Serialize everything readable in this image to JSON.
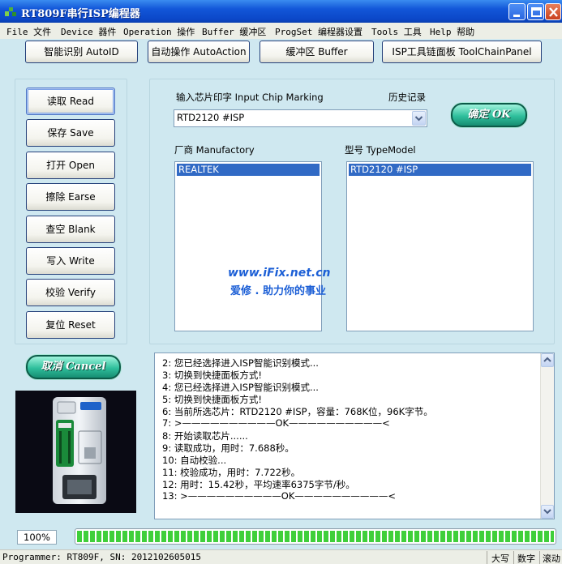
{
  "window": {
    "title": "RT809F串行ISP编程器"
  },
  "menu": [
    "File 文件",
    "Device 器件",
    "Operation 操作",
    "Buffer 缓冲区",
    "ProgSet 编程器设置",
    "Tools 工具",
    "Help 帮助"
  ],
  "toolbar": {
    "auto_identify": "智能识别 AutoID",
    "auto_action": "自动操作  AutoAction",
    "buffer": "缓冲区 Buffer",
    "toolchain": "ISP工具链面板  ToolChainPanel"
  },
  "ops": {
    "read": "读取 Read",
    "save": "保存 Save",
    "open": "打开 Open",
    "erase": "擦除 Earse",
    "blank": "查空 Blank",
    "write": "写入 Write",
    "verify": "校验 Verify",
    "reset": "复位 Reset"
  },
  "chip": {
    "marking_label": "输入芯片印字 Input Chip Marking",
    "history_label": "历史记录",
    "marking_value": "RTD2120 #ISP",
    "ok": "确定 OK",
    "manufactory_label": "厂商 Manufactory",
    "typemodel_label": "型号 TypeModel",
    "manufactory_selected": "REALTEK",
    "typemodel_selected": "RTD2120 #ISP"
  },
  "watermark": {
    "url": "www.iFix.net.cn",
    "slogan": "爱修 . 助力你的事业"
  },
  "cancel": "取消 Cancel",
  "log": [
    "2: 您已经选择进入ISP智能识别模式...",
    "3: 切换到快捷面板方式!",
    "4: 您已经选择进入ISP智能识别模式...",
    "5: 切换到快捷面板方式!",
    "6: 当前所选芯片：RTD2120 #ISP，容量：768K位，96K字节。",
    "7: >——————————OK——————————<",
    "8: 开始读取芯片......",
    "9: 读取成功，用时：7.688秒。",
    "10: 自动校验...",
    "11: 校验成功，用时：7.722秒。",
    "12: 用时：15.42秒，平均速率6375字节/秒。",
    "13: >——————————OK——————————<"
  ],
  "progress": {
    "percent_text": "100%",
    "value": 1.0
  },
  "status": {
    "programmer": "Programmer: RT809F, SN: 2012102605015",
    "caps": "大写",
    "num": "数字",
    "scroll": "滚动"
  }
}
